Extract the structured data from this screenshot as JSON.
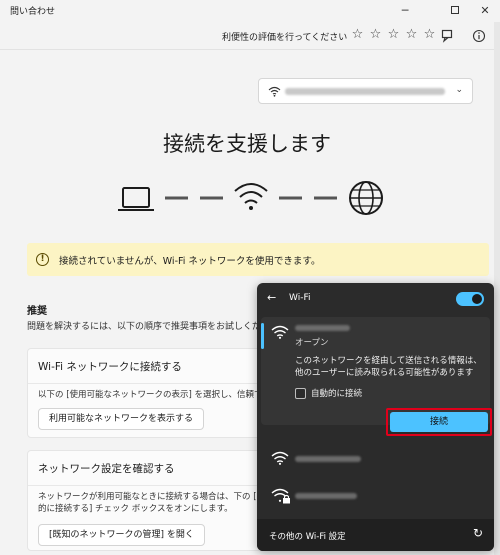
{
  "window": {
    "title": "問い合わせ"
  },
  "toolbar": {
    "rate_label": "利便性の評価を行ってください",
    "stars": [
      "☆",
      "☆",
      "☆",
      "☆",
      "☆"
    ]
  },
  "network_select": {
    "selected": ""
  },
  "page": {
    "title": "接続を支援します",
    "warning": "接続されていませんが、Wi-Fi ネットワークを使用できます。",
    "recommend_heading": "推奨",
    "recommend_desc": "問題を解決するには、以下の順序で推奨事項をお試しください"
  },
  "cards": [
    {
      "heading": "Wi-Fi ネットワークに接続する",
      "body": [
        "以下の [使用可能なネットワークの表示] を選択し、信頼でき"
      ],
      "button": "利用可能なネットワークを表示する"
    },
    {
      "heading": "ネットワーク設定を確認する",
      "body": [
        "ネットワークが利用可能なときに接続する場合は、下の [既知",
        "的に接続する] チェック ボックスをオンにします。"
      ],
      "button": "[既知のネットワークの管理] を開く"
    }
  ],
  "flyout": {
    "title": "Wi-Fi",
    "wifi_on": true,
    "expanded": {
      "status": "オープン",
      "warning": "このネットワークを経由して送信される情報は、他のユーザーに読み取られる可能性があります",
      "auto_connect_label": "自動的に接続",
      "connect_label": "接続"
    },
    "footer_label": "その他の Wi-Fi 設定"
  },
  "colors": {
    "accent": "#4cc2ff",
    "warning_bg": "#fcf4c4",
    "highlight": "#e0001b"
  }
}
